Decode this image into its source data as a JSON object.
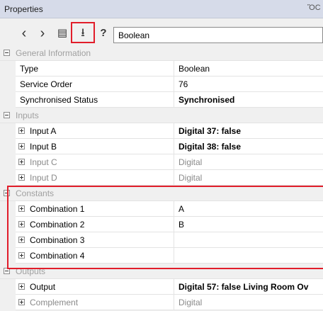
{
  "panel": {
    "title": "Properties",
    "pin_glyph": "ὌC"
  },
  "toolbar": {
    "back_glyph": "‹",
    "forward_glyph": "›",
    "page_glyph": "▤",
    "download_glyph": "⭳",
    "help_glyph": "?",
    "search_value": "Boolean",
    "highlight_color": "#e11d2a"
  },
  "sections": [
    {
      "label": "General Information",
      "rows": [
        {
          "name": "Type",
          "value": "Boolean",
          "bold": false,
          "grey": false,
          "expandable": false
        },
        {
          "name": "Service Order",
          "value": "76",
          "bold": false,
          "grey": false,
          "expandable": false
        },
        {
          "name": "Synchronised Status",
          "value": "Synchronised",
          "bold": true,
          "grey": false,
          "expandable": false
        }
      ]
    },
    {
      "label": "Inputs",
      "rows": [
        {
          "name": "Input A",
          "value": "Digital 37: false",
          "bold": true,
          "grey": false,
          "expandable": true
        },
        {
          "name": "Input B",
          "value": "Digital 38: false",
          "bold": true,
          "grey": false,
          "expandable": true
        },
        {
          "name": "Input C",
          "value": "Digital",
          "bold": false,
          "grey": true,
          "expandable": true
        },
        {
          "name": "Input D",
          "value": "Digital",
          "bold": false,
          "grey": true,
          "expandable": true
        }
      ]
    },
    {
      "label": "Constants",
      "rows": [
        {
          "name": "Combination 1",
          "value": "A",
          "bold": false,
          "grey": false,
          "expandable": true
        },
        {
          "name": "Combination 2",
          "value": "B",
          "bold": false,
          "grey": false,
          "expandable": true
        },
        {
          "name": "Combination 3",
          "value": "",
          "bold": false,
          "grey": false,
          "expandable": true
        },
        {
          "name": "Combination 4",
          "value": "",
          "bold": false,
          "grey": false,
          "expandable": true
        }
      ]
    },
    {
      "label": "Outputs",
      "rows": [
        {
          "name": "Output",
          "value": "Digital 57: false Living Room Ov",
          "bold": true,
          "grey": false,
          "expandable": true
        },
        {
          "name": "Complement",
          "value": "Digital",
          "bold": false,
          "grey": true,
          "expandable": true
        }
      ]
    }
  ]
}
